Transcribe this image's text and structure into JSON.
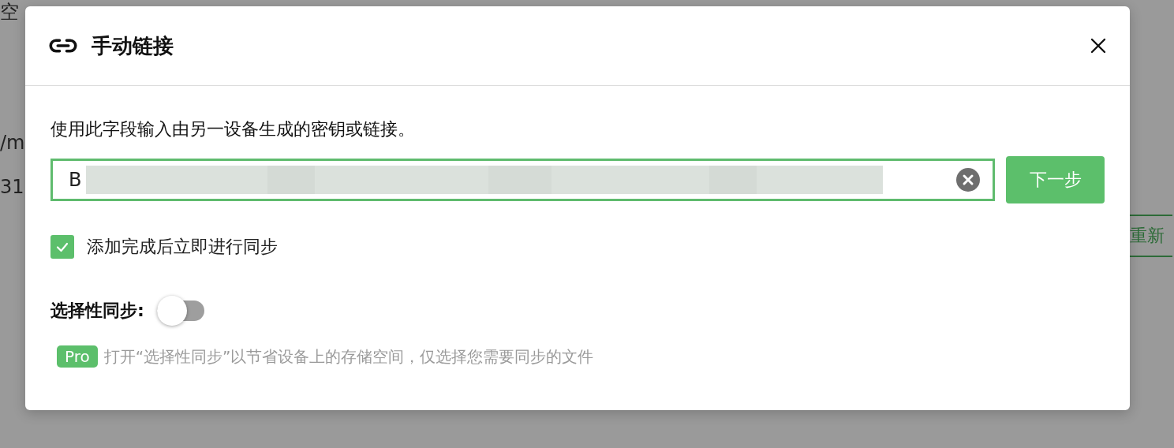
{
  "background": {
    "texts": [
      {
        "kind": "label",
        "text": "空"
      },
      {
        "kind": "label",
        "text": "/m"
      },
      {
        "kind": "label",
        "text": "31"
      },
      {
        "kind": "button",
        "text": "重新"
      }
    ]
  },
  "dialog": {
    "title": "手动链接",
    "instruction": "使用此字段输入由另一设备生成的密钥或链接。",
    "key_field": {
      "value": "B",
      "redacted": true
    },
    "next_button": "下一步",
    "sync_after_add": {
      "label": "添加完成后立即进行同步",
      "checked": true
    },
    "selective_sync": {
      "label": "选择性同步:",
      "on": false
    },
    "pro_badge": "Pro",
    "pro_hint": "打开“选择性同步”以节省设备上的存储空间，仅选择您需要同步的文件"
  }
}
